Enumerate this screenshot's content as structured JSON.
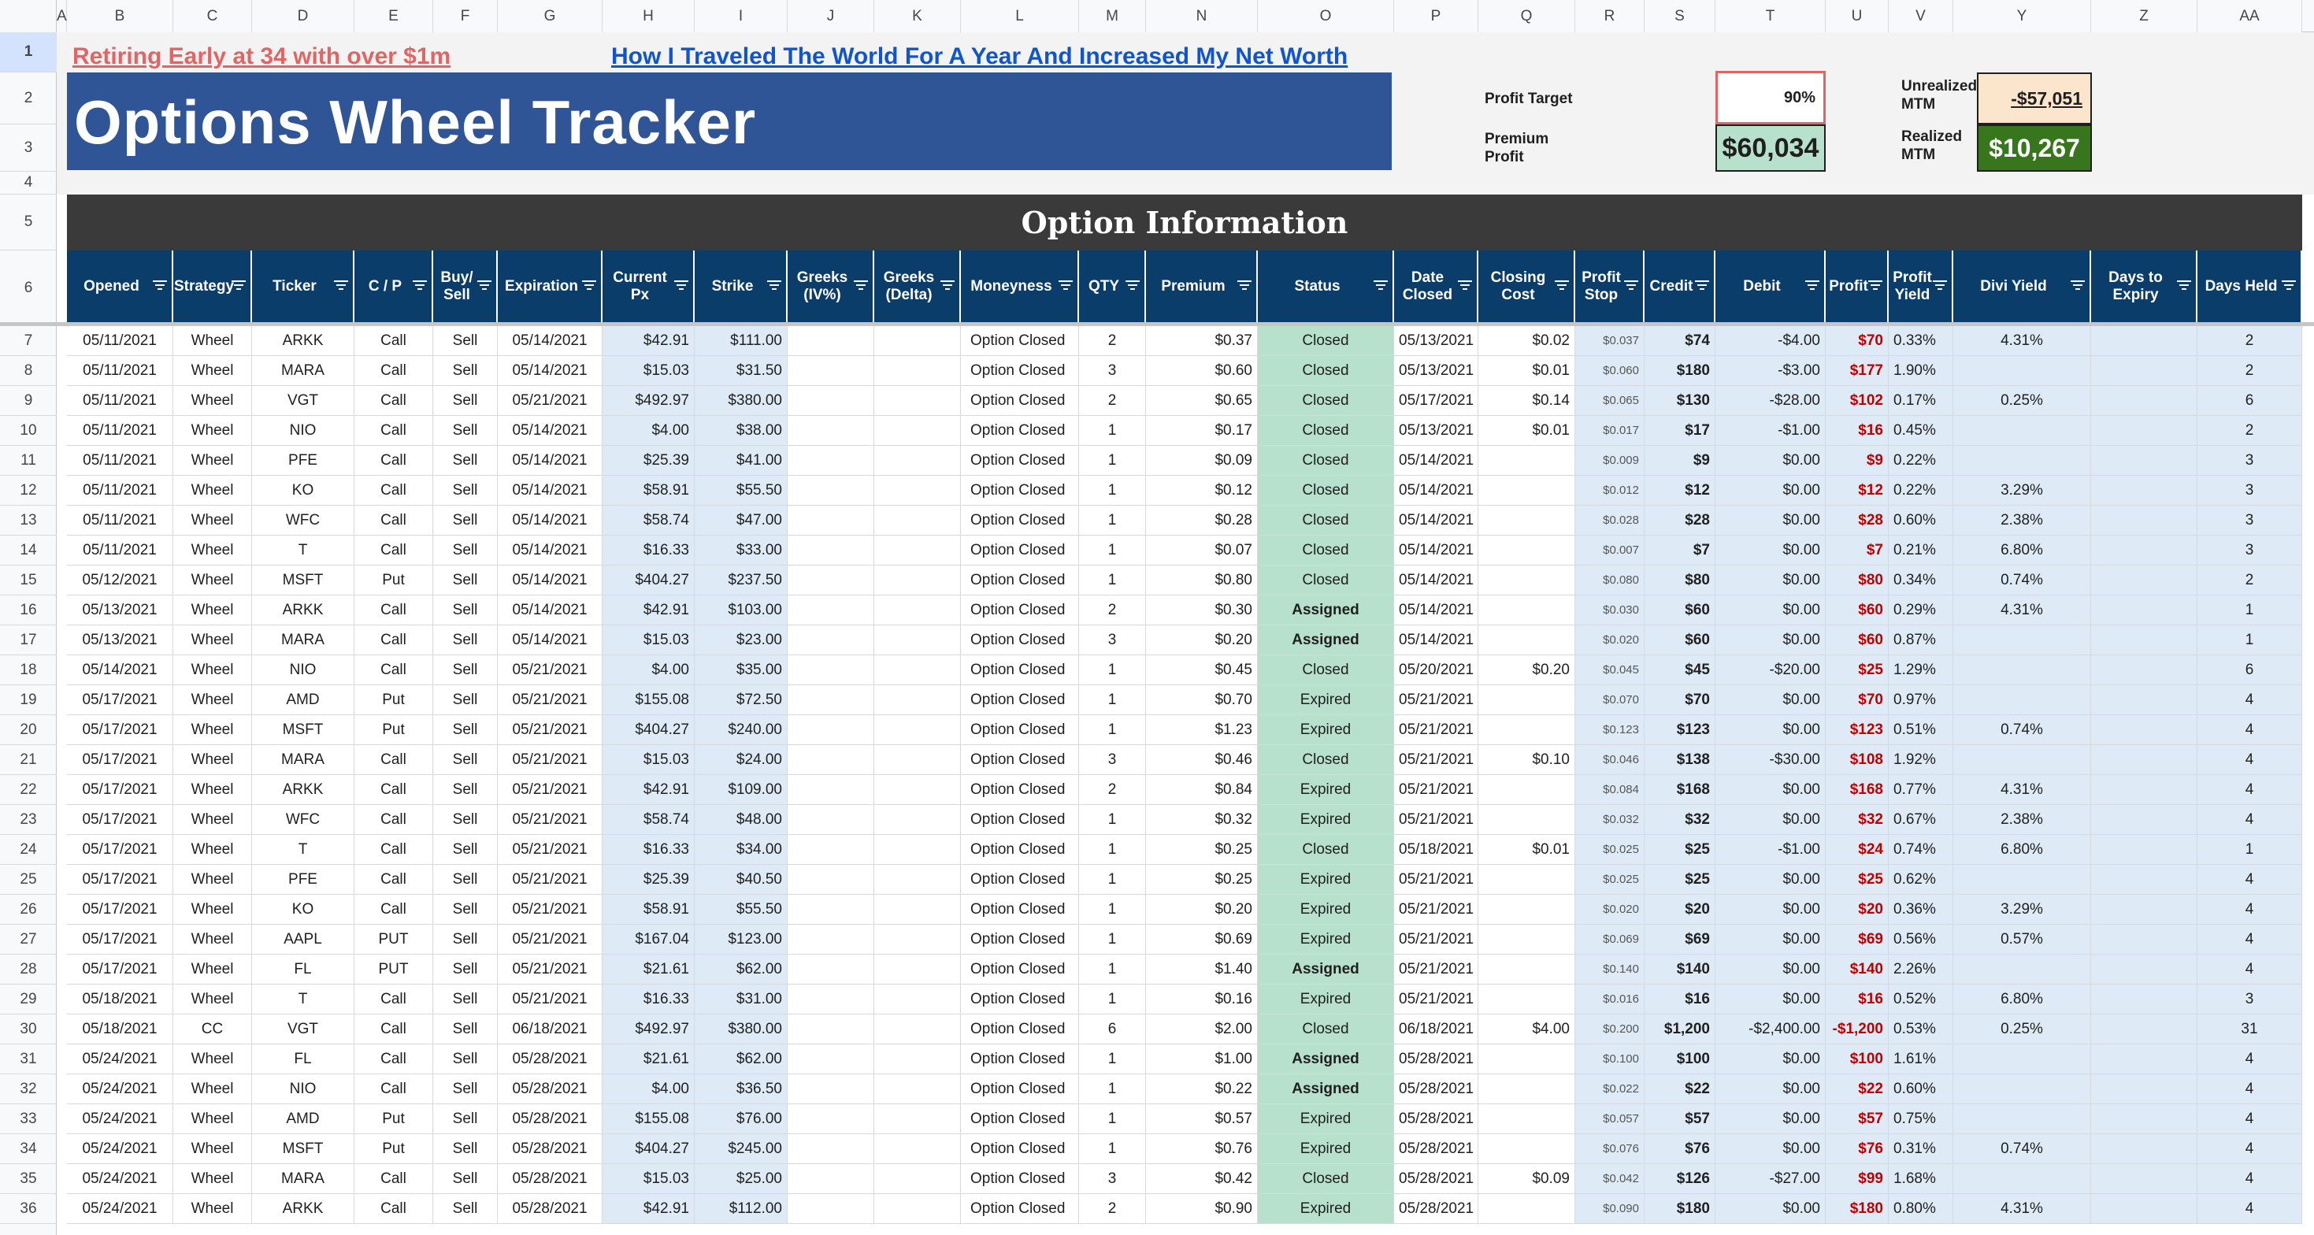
{
  "column_letters": [
    "A",
    "B",
    "C",
    "D",
    "E",
    "F",
    "G",
    "H",
    "I",
    "J",
    "K",
    "L",
    "M",
    "N",
    "O",
    "P",
    "Q",
    "R",
    "S",
    "T",
    "U",
    "V",
    "Y",
    "Z",
    "AA"
  ],
  "row_numbers": [
    "1",
    "2",
    "3",
    "4",
    "5",
    "6",
    "7",
    "8",
    "9",
    "10",
    "11",
    "12",
    "13",
    "14",
    "15",
    "16",
    "17",
    "18",
    "19",
    "20",
    "21",
    "22",
    "23",
    "24",
    "25",
    "26",
    "27",
    "28",
    "29",
    "30",
    "31",
    "32",
    "33",
    "34",
    "35",
    "36"
  ],
  "links": {
    "retiring": "Retiring Early at 34 with over $1m",
    "traveled": "How I Traveled The World For A Year And Increased My Net Worth"
  },
  "title": "Options Wheel Tracker",
  "summary": {
    "profit_target_label": "Profit Target",
    "profit_target_value": "90%",
    "premium_profit_label": "Premium Profit",
    "premium_profit_value": "$60,034",
    "unrealized_label": "Unrealized MTM",
    "unrealized_value": "-$57,051",
    "realized_label": "Realized MTM",
    "realized_value": "$10,267"
  },
  "section_title": "Option Information",
  "headers": [
    "Opened",
    "Strategy",
    "Ticker",
    "C / P",
    "Buy/ Sell",
    "Expiration",
    "Current Px",
    "Strike",
    "Greeks (IV%)",
    "Greeks (Delta)",
    "Moneyness",
    "QTY",
    "Premium",
    "Status",
    "Date Closed",
    "Closing Cost",
    "Profit Stop",
    "Credit",
    "Debit",
    "Profit",
    "Profit Yield",
    "Divi Yield",
    "Days to Expiry",
    "Days Held"
  ],
  "rows": [
    [
      "05/11/2021",
      "Wheel",
      "ARKK",
      "Call",
      "Sell",
      "05/14/2021",
      "$42.91",
      "$111.00",
      "",
      "",
      "Option Closed",
      "2",
      "$0.37",
      "Closed",
      "05/13/2021",
      "$0.02",
      "$0.037",
      "$74",
      "-$4.00",
      "$70",
      "0.33%",
      "4.31%",
      "",
      "2"
    ],
    [
      "05/11/2021",
      "Wheel",
      "MARA",
      "Call",
      "Sell",
      "05/14/2021",
      "$15.03",
      "$31.50",
      "",
      "",
      "Option Closed",
      "3",
      "$0.60",
      "Closed",
      "05/13/2021",
      "$0.01",
      "$0.060",
      "$180",
      "-$3.00",
      "$177",
      "1.90%",
      "",
      "",
      "2"
    ],
    [
      "05/11/2021",
      "Wheel",
      "VGT",
      "Call",
      "Sell",
      "05/21/2021",
      "$492.97",
      "$380.00",
      "",
      "",
      "Option Closed",
      "2",
      "$0.65",
      "Closed",
      "05/17/2021",
      "$0.14",
      "$0.065",
      "$130",
      "-$28.00",
      "$102",
      "0.17%",
      "0.25%",
      "",
      "6"
    ],
    [
      "05/11/2021",
      "Wheel",
      "NIO",
      "Call",
      "Sell",
      "05/14/2021",
      "$4.00",
      "$38.00",
      "",
      "",
      "Option Closed",
      "1",
      "$0.17",
      "Closed",
      "05/13/2021",
      "$0.01",
      "$0.017",
      "$17",
      "-$1.00",
      "$16",
      "0.45%",
      "",
      "",
      "2"
    ],
    [
      "05/11/2021",
      "Wheel",
      "PFE",
      "Call",
      "Sell",
      "05/14/2021",
      "$25.39",
      "$41.00",
      "",
      "",
      "Option Closed",
      "1",
      "$0.09",
      "Closed",
      "05/14/2021",
      "",
      "$0.009",
      "$9",
      "$0.00",
      "$9",
      "0.22%",
      "",
      "",
      "3"
    ],
    [
      "05/11/2021",
      "Wheel",
      "KO",
      "Call",
      "Sell",
      "05/14/2021",
      "$58.91",
      "$55.50",
      "",
      "",
      "Option Closed",
      "1",
      "$0.12",
      "Closed",
      "05/14/2021",
      "",
      "$0.012",
      "$12",
      "$0.00",
      "$12",
      "0.22%",
      "3.29%",
      "",
      "3"
    ],
    [
      "05/11/2021",
      "Wheel",
      "WFC",
      "Call",
      "Sell",
      "05/14/2021",
      "$58.74",
      "$47.00",
      "",
      "",
      "Option Closed",
      "1",
      "$0.28",
      "Closed",
      "05/14/2021",
      "",
      "$0.028",
      "$28",
      "$0.00",
      "$28",
      "0.60%",
      "2.38%",
      "",
      "3"
    ],
    [
      "05/11/2021",
      "Wheel",
      "T",
      "Call",
      "Sell",
      "05/14/2021",
      "$16.33",
      "$33.00",
      "",
      "",
      "Option Closed",
      "1",
      "$0.07",
      "Closed",
      "05/14/2021",
      "",
      "$0.007",
      "$7",
      "$0.00",
      "$7",
      "0.21%",
      "6.80%",
      "",
      "3"
    ],
    [
      "05/12/2021",
      "Wheel",
      "MSFT",
      "Put",
      "Sell",
      "05/14/2021",
      "$404.27",
      "$237.50",
      "",
      "",
      "Option Closed",
      "1",
      "$0.80",
      "Closed",
      "05/14/2021",
      "",
      "$0.080",
      "$80",
      "$0.00",
      "$80",
      "0.34%",
      "0.74%",
      "",
      "2"
    ],
    [
      "05/13/2021",
      "Wheel",
      "ARKK",
      "Call",
      "Sell",
      "05/14/2021",
      "$42.91",
      "$103.00",
      "",
      "",
      "Option Closed",
      "2",
      "$0.30",
      "Assigned",
      "05/14/2021",
      "",
      "$0.030",
      "$60",
      "$0.00",
      "$60",
      "0.29%",
      "4.31%",
      "",
      "1"
    ],
    [
      "05/13/2021",
      "Wheel",
      "MARA",
      "Call",
      "Sell",
      "05/14/2021",
      "$15.03",
      "$23.00",
      "",
      "",
      "Option Closed",
      "3",
      "$0.20",
      "Assigned",
      "05/14/2021",
      "",
      "$0.020",
      "$60",
      "$0.00",
      "$60",
      "0.87%",
      "",
      "",
      "1"
    ],
    [
      "05/14/2021",
      "Wheel",
      "NIO",
      "Call",
      "Sell",
      "05/21/2021",
      "$4.00",
      "$35.00",
      "",
      "",
      "Option Closed",
      "1",
      "$0.45",
      "Closed",
      "05/20/2021",
      "$0.20",
      "$0.045",
      "$45",
      "-$20.00",
      "$25",
      "1.29%",
      "",
      "",
      "6"
    ],
    [
      "05/17/2021",
      "Wheel",
      "AMD",
      "Put",
      "Sell",
      "05/21/2021",
      "$155.08",
      "$72.50",
      "",
      "",
      "Option Closed",
      "1",
      "$0.70",
      "Expired",
      "05/21/2021",
      "",
      "$0.070",
      "$70",
      "$0.00",
      "$70",
      "0.97%",
      "",
      "",
      "4"
    ],
    [
      "05/17/2021",
      "Wheel",
      "MSFT",
      "Put",
      "Sell",
      "05/21/2021",
      "$404.27",
      "$240.00",
      "",
      "",
      "Option Closed",
      "1",
      "$1.23",
      "Expired",
      "05/21/2021",
      "",
      "$0.123",
      "$123",
      "$0.00",
      "$123",
      "0.51%",
      "0.74%",
      "",
      "4"
    ],
    [
      "05/17/2021",
      "Wheel",
      "MARA",
      "Call",
      "Sell",
      "05/21/2021",
      "$15.03",
      "$24.00",
      "",
      "",
      "Option Closed",
      "3",
      "$0.46",
      "Closed",
      "05/21/2021",
      "$0.10",
      "$0.046",
      "$138",
      "-$30.00",
      "$108",
      "1.92%",
      "",
      "",
      "4"
    ],
    [
      "05/17/2021",
      "Wheel",
      "ARKK",
      "Call",
      "Sell",
      "05/21/2021",
      "$42.91",
      "$109.00",
      "",
      "",
      "Option Closed",
      "2",
      "$0.84",
      "Expired",
      "05/21/2021",
      "",
      "$0.084",
      "$168",
      "$0.00",
      "$168",
      "0.77%",
      "4.31%",
      "",
      "4"
    ],
    [
      "05/17/2021",
      "Wheel",
      "WFC",
      "Call",
      "Sell",
      "05/21/2021",
      "$58.74",
      "$48.00",
      "",
      "",
      "Option Closed",
      "1",
      "$0.32",
      "Expired",
      "05/21/2021",
      "",
      "$0.032",
      "$32",
      "$0.00",
      "$32",
      "0.67%",
      "2.38%",
      "",
      "4"
    ],
    [
      "05/17/2021",
      "Wheel",
      "T",
      "Call",
      "Sell",
      "05/21/2021",
      "$16.33",
      "$34.00",
      "",
      "",
      "Option Closed",
      "1",
      "$0.25",
      "Closed",
      "05/18/2021",
      "$0.01",
      "$0.025",
      "$25",
      "-$1.00",
      "$24",
      "0.74%",
      "6.80%",
      "",
      "1"
    ],
    [
      "05/17/2021",
      "Wheel",
      "PFE",
      "Call",
      "Sell",
      "05/21/2021",
      "$25.39",
      "$40.50",
      "",
      "",
      "Option Closed",
      "1",
      "$0.25",
      "Expired",
      "05/21/2021",
      "",
      "$0.025",
      "$25",
      "$0.00",
      "$25",
      "0.62%",
      "",
      "",
      "4"
    ],
    [
      "05/17/2021",
      "Wheel",
      "KO",
      "Call",
      "Sell",
      "05/21/2021",
      "$58.91",
      "$55.50",
      "",
      "",
      "Option Closed",
      "1",
      "$0.20",
      "Expired",
      "05/21/2021",
      "",
      "$0.020",
      "$20",
      "$0.00",
      "$20",
      "0.36%",
      "3.29%",
      "",
      "4"
    ],
    [
      "05/17/2021",
      "Wheel",
      "AAPL",
      "PUT",
      "Sell",
      "05/21/2021",
      "$167.04",
      "$123.00",
      "",
      "",
      "Option Closed",
      "1",
      "$0.69",
      "Expired",
      "05/21/2021",
      "",
      "$0.069",
      "$69",
      "$0.00",
      "$69",
      "0.56%",
      "0.57%",
      "",
      "4"
    ],
    [
      "05/17/2021",
      "Wheel",
      "FL",
      "PUT",
      "Sell",
      "05/21/2021",
      "$21.61",
      "$62.00",
      "",
      "",
      "Option Closed",
      "1",
      "$1.40",
      "Assigned",
      "05/21/2021",
      "",
      "$0.140",
      "$140",
      "$0.00",
      "$140",
      "2.26%",
      "",
      "",
      "4"
    ],
    [
      "05/18/2021",
      "Wheel",
      "T",
      "Call",
      "Sell",
      "05/21/2021",
      "$16.33",
      "$31.00",
      "",
      "",
      "Option Closed",
      "1",
      "$0.16",
      "Expired",
      "05/21/2021",
      "",
      "$0.016",
      "$16",
      "$0.00",
      "$16",
      "0.52%",
      "6.80%",
      "",
      "3"
    ],
    [
      "05/18/2021",
      "CC",
      "VGT",
      "Call",
      "Sell",
      "06/18/2021",
      "$492.97",
      "$380.00",
      "",
      "",
      "Option Closed",
      "6",
      "$2.00",
      "Closed",
      "06/18/2021",
      "$4.00",
      "$0.200",
      "$1,200",
      "-$2,400.00",
      "-$1,200",
      "0.53%",
      "0.25%",
      "",
      "31"
    ],
    [
      "05/24/2021",
      "Wheel",
      "FL",
      "Call",
      "Sell",
      "05/28/2021",
      "$21.61",
      "$62.00",
      "",
      "",
      "Option Closed",
      "1",
      "$1.00",
      "Assigned",
      "05/28/2021",
      "",
      "$0.100",
      "$100",
      "$0.00",
      "$100",
      "1.61%",
      "",
      "",
      "4"
    ],
    [
      "05/24/2021",
      "Wheel",
      "NIO",
      "Call",
      "Sell",
      "05/28/2021",
      "$4.00",
      "$36.50",
      "",
      "",
      "Option Closed",
      "1",
      "$0.22",
      "Assigned",
      "05/28/2021",
      "",
      "$0.022",
      "$22",
      "$0.00",
      "$22",
      "0.60%",
      "",
      "",
      "4"
    ],
    [
      "05/24/2021",
      "Wheel",
      "AMD",
      "Put",
      "Sell",
      "05/28/2021",
      "$155.08",
      "$76.00",
      "",
      "",
      "Option Closed",
      "1",
      "$0.57",
      "Expired",
      "05/28/2021",
      "",
      "$0.057",
      "$57",
      "$0.00",
      "$57",
      "0.75%",
      "",
      "",
      "4"
    ],
    [
      "05/24/2021",
      "Wheel",
      "MSFT",
      "Put",
      "Sell",
      "05/28/2021",
      "$404.27",
      "$245.00",
      "",
      "",
      "Option Closed",
      "1",
      "$0.76",
      "Expired",
      "05/28/2021",
      "",
      "$0.076",
      "$76",
      "$0.00",
      "$76",
      "0.31%",
      "0.74%",
      "",
      "4"
    ],
    [
      "05/24/2021",
      "Wheel",
      "MARA",
      "Call",
      "Sell",
      "05/28/2021",
      "$15.03",
      "$25.00",
      "",
      "",
      "Option Closed",
      "3",
      "$0.42",
      "Closed",
      "05/28/2021",
      "$0.09",
      "$0.042",
      "$126",
      "-$27.00",
      "$99",
      "1.68%",
      "",
      "",
      "4"
    ],
    [
      "05/24/2021",
      "Wheel",
      "ARKK",
      "Call",
      "Sell",
      "05/28/2021",
      "$42.91",
      "$112.00",
      "",
      "",
      "Option Closed",
      "2",
      "$0.90",
      "Expired",
      "05/28/2021",
      "",
      "$0.090",
      "$180",
      "$0.00",
      "$180",
      "0.80%",
      "4.31%",
      "",
      "4"
    ]
  ],
  "colors": {
    "banner": "#2f5597",
    "section": "#3a3a3a",
    "header": "#0b3d6b",
    "blue_cell": "#deebf7",
    "status_green": "#b7e1cd",
    "profit_red": "#c00000",
    "realized_green": "#38761d",
    "premium_green": "#b7e1cd",
    "unrealized_orange": "#fce5cd"
  }
}
